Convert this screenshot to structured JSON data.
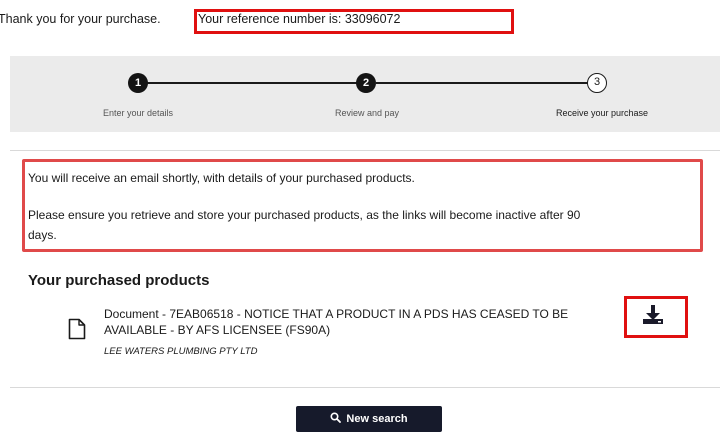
{
  "header": {
    "thankyou_text": "Thank you for your purchase.",
    "reference_text": "Your reference number is: 33096072"
  },
  "steps": [
    {
      "number": "1",
      "label": "Enter your details",
      "state": "completed"
    },
    {
      "number": "2",
      "label": "Review and pay",
      "state": "completed"
    },
    {
      "number": "3",
      "label": "Receive your purchase",
      "state": "current"
    }
  ],
  "notice": {
    "line1": "You will receive an email shortly, with details of your purchased products.",
    "line2a": "Please ensure you retrieve and store your purchased products, as the links will become inactive after 90",
    "line2b": "days."
  },
  "products": {
    "title": "Your purchased products",
    "items": [
      {
        "title_line1": "Document - 7EAB06518 - NOTICE THAT A PRODUCT IN A PDS HAS CEASED TO BE",
        "title_line2": "AVAILABLE  - BY AFS LICENSEE (FS90A)",
        "company": "LEE WATERS PLUMBING PTY LTD",
        "icon": "document-icon",
        "action_icon": "download-icon"
      }
    ]
  },
  "actions": {
    "new_search_label": "New search",
    "new_search_icon": "search-icon"
  },
  "colors": {
    "highlight_red": "#e01010",
    "stepper_bg": "#ebebeb",
    "button_bg": "#161a2b"
  }
}
